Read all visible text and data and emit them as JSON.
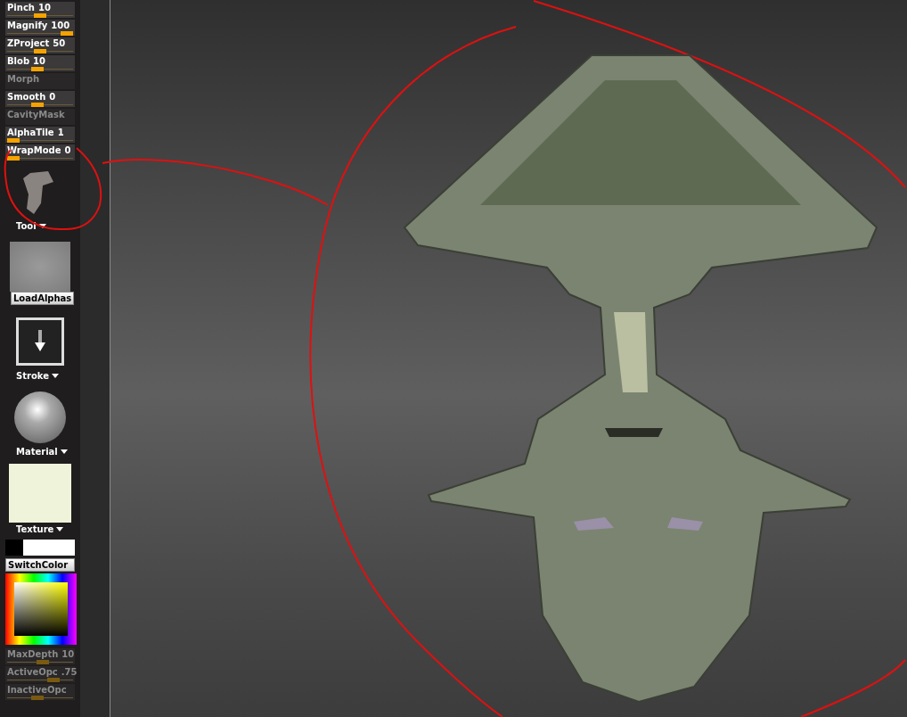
{
  "top_sliders": [
    {
      "kind": "slider",
      "label": "Pinch",
      "value": "10",
      "disabled": false,
      "level": 0.5
    },
    {
      "kind": "slider",
      "label": "Magnify",
      "value": "100",
      "disabled": false,
      "level": 1
    },
    {
      "kind": "slider",
      "label": "ZProject",
      "value": "50",
      "disabled": false,
      "level": 0.5
    },
    {
      "kind": "slider",
      "label": "Blob",
      "value": "10",
      "disabled": false,
      "level": 0.45
    },
    {
      "kind": "button",
      "label": "Morph",
      "disabled": true
    },
    {
      "kind": "slider",
      "label": "Smooth",
      "value": "0",
      "disabled": false,
      "level": 0.45
    },
    {
      "kind": "button",
      "label": "CavityMask",
      "disabled": true
    },
    {
      "kind": "slider",
      "label": "AlphaTile",
      "value": "1",
      "disabled": false,
      "level": 0
    },
    {
      "kind": "slider",
      "label": "WrapMode",
      "value": "0",
      "disabled": false,
      "level": 0
    }
  ],
  "tool": {
    "label": "Tool"
  },
  "alpha": {
    "button": "LoadAlphas"
  },
  "stroke": {
    "label": "Stroke"
  },
  "material": {
    "label": "Material"
  },
  "texture": {
    "label": "Texture"
  },
  "colors": {
    "swatches": [
      {
        "color": "#000000"
      },
      {
        "color": "#ffffff"
      }
    ],
    "button": "SwitchColor"
  },
  "bottom_sliders": [
    {
      "kind": "slider",
      "label": "MaxDepth",
      "value": "10",
      "disabled": true,
      "level": 0.55
    },
    {
      "kind": "slider",
      "label": "ActiveOpc",
      "value": ".75",
      "disabled": true,
      "level": 0.75
    },
    {
      "kind": "slider",
      "label": "InactiveOpc",
      "disabled": true,
      "level": 0.45
    }
  ]
}
